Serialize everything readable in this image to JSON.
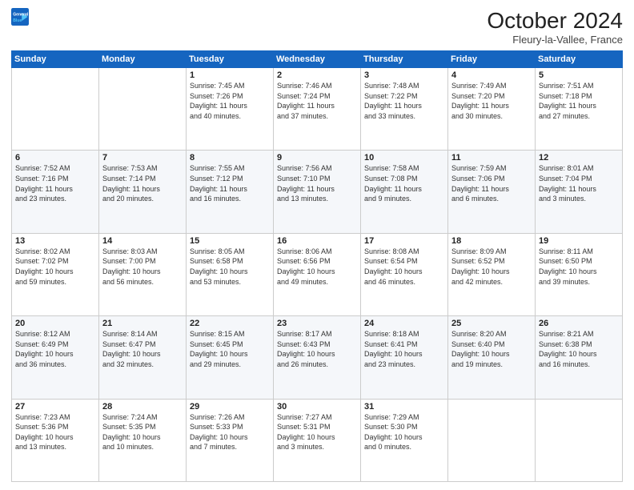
{
  "logo": {
    "line1": "General",
    "line2": "Blue"
  },
  "header": {
    "title": "October 2024",
    "location": "Fleury-la-Vallee, France"
  },
  "weekdays": [
    "Sunday",
    "Monday",
    "Tuesday",
    "Wednesday",
    "Thursday",
    "Friday",
    "Saturday"
  ],
  "weeks": [
    [
      {
        "day": "",
        "info": ""
      },
      {
        "day": "",
        "info": ""
      },
      {
        "day": "1",
        "info": "Sunrise: 7:45 AM\nSunset: 7:26 PM\nDaylight: 11 hours\nand 40 minutes."
      },
      {
        "day": "2",
        "info": "Sunrise: 7:46 AM\nSunset: 7:24 PM\nDaylight: 11 hours\nand 37 minutes."
      },
      {
        "day": "3",
        "info": "Sunrise: 7:48 AM\nSunset: 7:22 PM\nDaylight: 11 hours\nand 33 minutes."
      },
      {
        "day": "4",
        "info": "Sunrise: 7:49 AM\nSunset: 7:20 PM\nDaylight: 11 hours\nand 30 minutes."
      },
      {
        "day": "5",
        "info": "Sunrise: 7:51 AM\nSunset: 7:18 PM\nDaylight: 11 hours\nand 27 minutes."
      }
    ],
    [
      {
        "day": "6",
        "info": "Sunrise: 7:52 AM\nSunset: 7:16 PM\nDaylight: 11 hours\nand 23 minutes."
      },
      {
        "day": "7",
        "info": "Sunrise: 7:53 AM\nSunset: 7:14 PM\nDaylight: 11 hours\nand 20 minutes."
      },
      {
        "day": "8",
        "info": "Sunrise: 7:55 AM\nSunset: 7:12 PM\nDaylight: 11 hours\nand 16 minutes."
      },
      {
        "day": "9",
        "info": "Sunrise: 7:56 AM\nSunset: 7:10 PM\nDaylight: 11 hours\nand 13 minutes."
      },
      {
        "day": "10",
        "info": "Sunrise: 7:58 AM\nSunset: 7:08 PM\nDaylight: 11 hours\nand 9 minutes."
      },
      {
        "day": "11",
        "info": "Sunrise: 7:59 AM\nSunset: 7:06 PM\nDaylight: 11 hours\nand 6 minutes."
      },
      {
        "day": "12",
        "info": "Sunrise: 8:01 AM\nSunset: 7:04 PM\nDaylight: 11 hours\nand 3 minutes."
      }
    ],
    [
      {
        "day": "13",
        "info": "Sunrise: 8:02 AM\nSunset: 7:02 PM\nDaylight: 10 hours\nand 59 minutes."
      },
      {
        "day": "14",
        "info": "Sunrise: 8:03 AM\nSunset: 7:00 PM\nDaylight: 10 hours\nand 56 minutes."
      },
      {
        "day": "15",
        "info": "Sunrise: 8:05 AM\nSunset: 6:58 PM\nDaylight: 10 hours\nand 53 minutes."
      },
      {
        "day": "16",
        "info": "Sunrise: 8:06 AM\nSunset: 6:56 PM\nDaylight: 10 hours\nand 49 minutes."
      },
      {
        "day": "17",
        "info": "Sunrise: 8:08 AM\nSunset: 6:54 PM\nDaylight: 10 hours\nand 46 minutes."
      },
      {
        "day": "18",
        "info": "Sunrise: 8:09 AM\nSunset: 6:52 PM\nDaylight: 10 hours\nand 42 minutes."
      },
      {
        "day": "19",
        "info": "Sunrise: 8:11 AM\nSunset: 6:50 PM\nDaylight: 10 hours\nand 39 minutes."
      }
    ],
    [
      {
        "day": "20",
        "info": "Sunrise: 8:12 AM\nSunset: 6:49 PM\nDaylight: 10 hours\nand 36 minutes."
      },
      {
        "day": "21",
        "info": "Sunrise: 8:14 AM\nSunset: 6:47 PM\nDaylight: 10 hours\nand 32 minutes."
      },
      {
        "day": "22",
        "info": "Sunrise: 8:15 AM\nSunset: 6:45 PM\nDaylight: 10 hours\nand 29 minutes."
      },
      {
        "day": "23",
        "info": "Sunrise: 8:17 AM\nSunset: 6:43 PM\nDaylight: 10 hours\nand 26 minutes."
      },
      {
        "day": "24",
        "info": "Sunrise: 8:18 AM\nSunset: 6:41 PM\nDaylight: 10 hours\nand 23 minutes."
      },
      {
        "day": "25",
        "info": "Sunrise: 8:20 AM\nSunset: 6:40 PM\nDaylight: 10 hours\nand 19 minutes."
      },
      {
        "day": "26",
        "info": "Sunrise: 8:21 AM\nSunset: 6:38 PM\nDaylight: 10 hours\nand 16 minutes."
      }
    ],
    [
      {
        "day": "27",
        "info": "Sunrise: 7:23 AM\nSunset: 5:36 PM\nDaylight: 10 hours\nand 13 minutes."
      },
      {
        "day": "28",
        "info": "Sunrise: 7:24 AM\nSunset: 5:35 PM\nDaylight: 10 hours\nand 10 minutes."
      },
      {
        "day": "29",
        "info": "Sunrise: 7:26 AM\nSunset: 5:33 PM\nDaylight: 10 hours\nand 7 minutes."
      },
      {
        "day": "30",
        "info": "Sunrise: 7:27 AM\nSunset: 5:31 PM\nDaylight: 10 hours\nand 3 minutes."
      },
      {
        "day": "31",
        "info": "Sunrise: 7:29 AM\nSunset: 5:30 PM\nDaylight: 10 hours\nand 0 minutes."
      },
      {
        "day": "",
        "info": ""
      },
      {
        "day": "",
        "info": ""
      }
    ]
  ]
}
